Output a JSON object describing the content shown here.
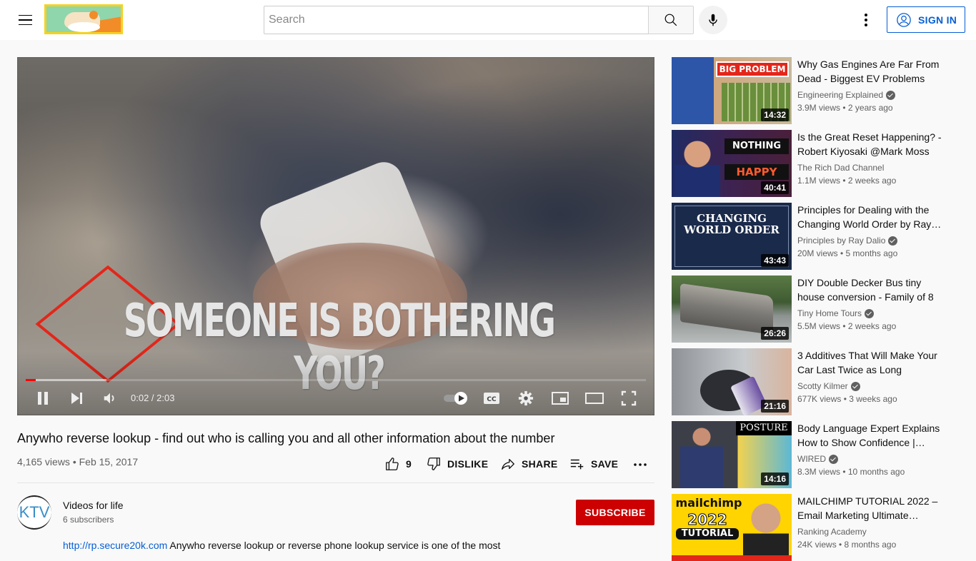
{
  "header": {
    "search_placeholder": "Search",
    "search_value": "",
    "sign_in_label": "SIGN IN",
    "icons": {
      "menu": "hamburger-menu-icon",
      "search": "search-icon",
      "mic": "microphone-icon",
      "more": "more-vertical-icon",
      "account": "account-circle-icon"
    }
  },
  "player": {
    "overlay_text": "SOMEONE IS BOTHERING YOU?",
    "current_time": "0:02",
    "duration": "2:03",
    "time_display": "0:02 / 2:03",
    "progress_played_fraction": 0.016,
    "progress_loaded_fraction": 0.13,
    "autoplay_enabled": true,
    "controls": [
      "pause",
      "next",
      "volume",
      "autoplay-toggle",
      "captions",
      "settings",
      "miniplayer",
      "theater-mode",
      "fullscreen"
    ],
    "colors": {
      "progress": "#ff0000"
    }
  },
  "video": {
    "title": "Anywho reverse lookup - find out who is calling you and all other information about the number",
    "views": "4,165 views",
    "date": "Feb 15, 2017",
    "meta_line": "4,165 views • Feb 15, 2017",
    "likes": "9",
    "dislike_label": "DISLIKE",
    "share_label": "SHARE",
    "save_label": "SAVE"
  },
  "channel": {
    "name": "Videos for life",
    "subscribers": "6 subscribers",
    "avatar_text": "KTV",
    "subscribe_label": "SUBSCRIBE",
    "subscribe_color": "#cc0000"
  },
  "description": {
    "link": "http://rp.secure20k.com",
    "text": " Anywho reverse lookup or reverse phone lookup service is one of the most"
  },
  "recommendations": [
    {
      "title": "Why Gas Engines Are Far From Dead - Biggest EV Problems",
      "channel": "Engineering Explained",
      "verified": true,
      "views": "3.9M views",
      "age": "2 years ago",
      "meta": "3.9M views • 2 years ago",
      "duration": "14:32",
      "thumb_text": "BIG PROBLEM"
    },
    {
      "title": "Is the Great Reset Happening? - Robert Kiyosaki @Mark Moss",
      "channel": "The Rich Dad Channel",
      "verified": false,
      "views": "1.1M views",
      "age": "2 weeks ago",
      "meta": "1.1M views • 2 weeks ago",
      "duration": "40:41",
      "thumb_text": "YOU'LL OWN NOTHING And Be HAPPY"
    },
    {
      "title": "Principles for Dealing with the Changing World Order by Ray…",
      "channel": "Principles by Ray Dalio",
      "verified": true,
      "views": "20M views",
      "age": "5 months ago",
      "meta": "20M views • 5 months ago",
      "duration": "43:43",
      "thumb_text": "CHANGING WORLD ORDER"
    },
    {
      "title": "DIY Double Decker Bus tiny house conversion - Family of 8",
      "channel": "Tiny Home Tours",
      "verified": true,
      "views": "5.5M views",
      "age": "2 weeks ago",
      "meta": "5.5M views • 2 weeks ago",
      "duration": "26:26",
      "thumb_text": ""
    },
    {
      "title": "3 Additives That Will Make Your Car Last Twice as Long",
      "channel": "Scotty Kilmer",
      "verified": true,
      "views": "677K views",
      "age": "3 weeks ago",
      "meta": "677K views • 3 weeks ago",
      "duration": "21:16",
      "thumb_text": ""
    },
    {
      "title": "Body Language Expert Explains How to Show Confidence |…",
      "channel": "WIRED",
      "verified": true,
      "views": "8.3M views",
      "age": "10 months ago",
      "meta": "8.3M views • 10 months ago",
      "duration": "14:16",
      "thumb_text": "POSTURE"
    },
    {
      "title": "MAILCHIMP TUTORIAL 2022 – Email Marketing Ultimate…",
      "channel": "Ranking Academy",
      "verified": false,
      "views": "24K views",
      "age": "8 months ago",
      "meta": "24K views • 8 months ago",
      "duration": "",
      "thumb_text": "mailchimp 2022 TUTORIAL"
    }
  ]
}
